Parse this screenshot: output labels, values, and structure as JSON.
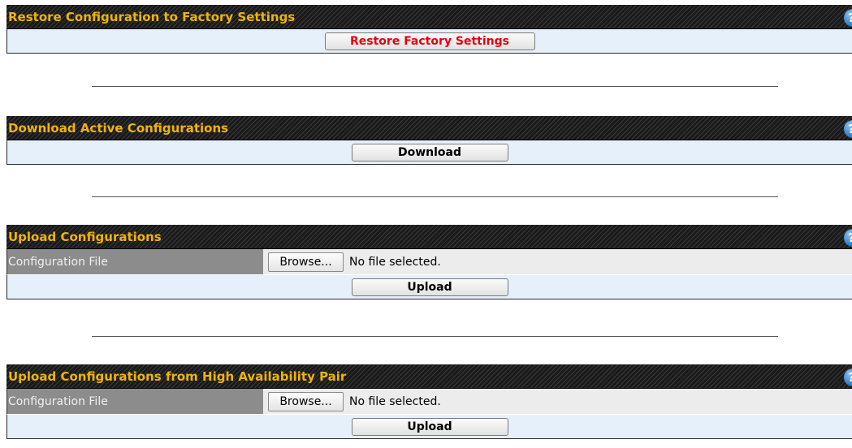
{
  "restore_section": {
    "title": "Restore Configuration to Factory Settings",
    "help": "?",
    "button_label": "Restore Factory Settings"
  },
  "download_section": {
    "title": "Download Active Configurations",
    "help": "?",
    "button_label": "Download"
  },
  "upload_section": {
    "title": "Upload Configurations",
    "help": "?",
    "field_label": "Configuration File",
    "browse_label": "Browse...",
    "file_status": "No file selected.",
    "button_label": "Upload"
  },
  "ha_upload_section": {
    "title": "Upload Configurations from High Availability Pair",
    "help": "?",
    "field_label": "Configuration File",
    "browse_label": "Browse...",
    "file_status": "No file selected.",
    "button_label": "Upload"
  },
  "colors": {
    "header_bg": "#1a1a1a",
    "header_text": "#f0b30a",
    "action_row_bg": "#e6f0fb",
    "label_bg": "#8c8c8c",
    "restore_text": "#e8000d",
    "help_icon": "#3b85cf"
  }
}
